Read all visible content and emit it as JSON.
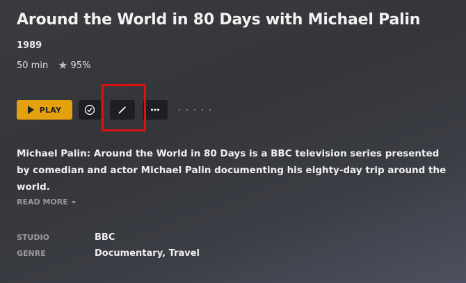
{
  "title": "Around the World in 80 Days with Michael Palin",
  "year": "1989",
  "duration": "50 min",
  "rating": "95%",
  "icons": {
    "star": "star-icon",
    "play": "play-icon",
    "check": "check-circle-icon",
    "edit": "pencil-icon",
    "more": "ellipsis-icon"
  },
  "actions": {
    "play_label": "PLAY"
  },
  "summary": "Michael Palin: Around the World in 80 Days is a BBC television series presented by comedian and actor Michael Palin documenting his eighty-day trip around the world.",
  "read_more": "READ MORE",
  "details": {
    "studio_label": "STUDIO",
    "studio_value": "BBC",
    "genre_label": "GENRE",
    "genre_value": "Documentary, Travel"
  },
  "colors": {
    "accent": "#e5a00d",
    "highlight": "#e01010",
    "button_bg": "#1e1f22"
  }
}
